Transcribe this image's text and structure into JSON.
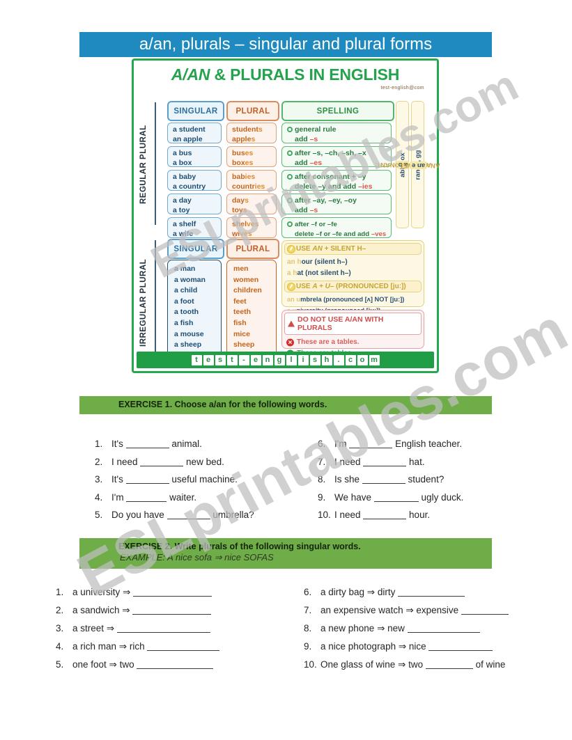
{
  "page": {
    "title": "a/an, plurals – singular and plural forms",
    "watermark": "ESLprintables.com"
  },
  "infographic": {
    "title_italic": "A/AN",
    "title_rest": " & PLURALS IN ENGLISH",
    "logo_small": "test-english@com",
    "footer": "test-english.com",
    "sections": {
      "regular_label": "REGULAR PLURAL",
      "irregular_label": "IRREGULAR PLURAL"
    },
    "columns": {
      "singular": "SINGULAR",
      "plural": "PLURAL",
      "spelling": "SPELLING"
    },
    "regular_rows": [
      {
        "singular": [
          "a student",
          "an apple"
        ],
        "plural_stem": [
          "student",
          "apple"
        ],
        "plural_end": [
          "s",
          "s"
        ],
        "rule_line1": "general rule",
        "rule_line2_pre": "add ",
        "rule_line2_hl": "–s"
      },
      {
        "singular": [
          "a bus",
          "a box"
        ],
        "plural_stem": [
          "bus",
          "box"
        ],
        "plural_end": [
          "es",
          "es"
        ],
        "rule_line1": "after –s, –ch, –sh, –x",
        "rule_line2_pre": "add ",
        "rule_line2_hl": "–es"
      },
      {
        "singular": [
          "a baby",
          "a country"
        ],
        "plural_stem": [
          "bab",
          "countr"
        ],
        "plural_end": [
          "ies",
          "ies"
        ],
        "rule_line1": "after consonant + –y",
        "rule_line2_pre": "delete –y and add ",
        "rule_line2_hl": "–ies"
      },
      {
        "singular": [
          "a day",
          "a toy"
        ],
        "plural_stem": [
          "day",
          "toy"
        ],
        "plural_end": [
          "s",
          "s"
        ],
        "rule_line1": "after –ay, –ey, –oy",
        "rule_line2_pre": "add ",
        "rule_line2_hl": "–s"
      },
      {
        "singular": [
          "a shelf",
          "a wife"
        ],
        "plural_stem": [
          "shel",
          "wi"
        ],
        "plural_end": [
          "ves",
          "ves"
        ],
        "rule_line1": "after –f or –fe",
        "rule_line2_pre": "delete –f or –fe and add ",
        "rule_line2_hl": "–ves"
      }
    ],
    "irregular": {
      "singular": [
        "a man",
        "a woman",
        "a child",
        "a foot",
        "a tooth",
        "a fish",
        "a mouse",
        "a sheep"
      ],
      "plural": [
        "men",
        "women",
        "children",
        "feet",
        "teeth",
        "fish",
        "mice",
        "sheep"
      ]
    },
    "strips": [
      {
        "label": "A + CONSONANT:",
        "examples_a": "a t",
        "examples_a_rest": "able,",
        "examples_b": "a b",
        "examples_b_rest": "ox"
      },
      {
        "label": "AN + VOWEL:",
        "examples_a": "an o",
        "examples_a_rest": "range,",
        "examples_b": "an e",
        "examples_b_rest": "gg"
      }
    ],
    "yellow_panel": {
      "rule1_title_pre": "USE ",
      "rule1_title_ital": "AN",
      "rule1_title_post": " + SILENT H–",
      "rule1_lines": [
        {
          "pre": "an h",
          "rest": "our (silent h–)"
        },
        {
          "pre": "a h",
          "rest": "at (not silent h–)"
        }
      ],
      "rule2_title_pre": "USE ",
      "rule2_title_ital": "A + U–",
      "rule2_title_post": " (PRONOUNCED [juː])",
      "rule2_lines": [
        {
          "pre": "an u",
          "rest": "mbrela (pronounced [ʌ] NOT [juː])"
        },
        {
          "pre": "a u",
          "rest": "niversity (pronounced [juː])"
        }
      ]
    },
    "red_panel": {
      "title": "DO NOT USE A/AN WITH PLURALS",
      "bad": "These are a tables.",
      "good": "These are tables."
    }
  },
  "exercise1": {
    "title": "EXERCISE 1. Choose a/an for the following words.",
    "left": [
      {
        "num": "1.",
        "pre": "It's",
        "post": "animal.",
        "blank": 62
      },
      {
        "num": "2.",
        "pre": "I need",
        "post": "new bed.",
        "blank": 62
      },
      {
        "num": "3.",
        "pre": "It's",
        "post": "useful machine.",
        "blank": 62
      },
      {
        "num": "4.",
        "pre": "I'm",
        "post": "waiter.",
        "blank": 58
      },
      {
        "num": "5.",
        "pre": "Do you have",
        "post": "umbrella?",
        "blank": 62
      }
    ],
    "right": [
      {
        "num": "6.",
        "pre": "I'm",
        "post": "English teacher.",
        "blank": 62
      },
      {
        "num": "7.",
        "pre": "I need",
        "post": "hat.",
        "blank": 62
      },
      {
        "num": "8.",
        "pre": "Is she",
        "post": "student?",
        "blank": 62
      },
      {
        "num": "9.",
        "pre": "We have",
        "post": "ugly duck.",
        "blank": 64
      },
      {
        "num": "10.",
        "pre": "I need",
        "post": "hour.",
        "blank": 62
      }
    ]
  },
  "exercise2": {
    "title": "EXERCISE 2. Write plurals of the following singular words.",
    "example": "EXAMPLE: A nice sofa ⇒ nice SOFAS",
    "left": [
      {
        "num": "1.",
        "pre": "a university ⇒",
        "post": "",
        "blank": 113
      },
      {
        "num": "2.",
        "pre": "a sandwich ⇒",
        "post": "",
        "blank": 113
      },
      {
        "num": "3.",
        "pre": "a street ⇒",
        "post": "",
        "blank": 134
      },
      {
        "num": "4.",
        "pre": "a rich man ⇒ rich",
        "post": "",
        "blank": 104
      },
      {
        "num": "5.",
        "pre": "one foot ⇒ two",
        "post": "",
        "blank": 110
      }
    ],
    "right": [
      {
        "num": "6.",
        "pre": "a dirty bag ⇒ dirty",
        "post": "",
        "blank": 96
      },
      {
        "num": "7.",
        "pre": "an expensive watch ⇒ expensive",
        "post": "",
        "blank": 68
      },
      {
        "num": "8.",
        "pre": "a new phone ⇒ new",
        "post": "",
        "blank": 104
      },
      {
        "num": "9.",
        "pre": "a nice photograph ⇒ nice",
        "post": "",
        "blank": 92
      },
      {
        "num": "10.",
        "pre": "One glass of wine ⇒ two",
        "post": "of wine",
        "blank": 68
      }
    ]
  }
}
